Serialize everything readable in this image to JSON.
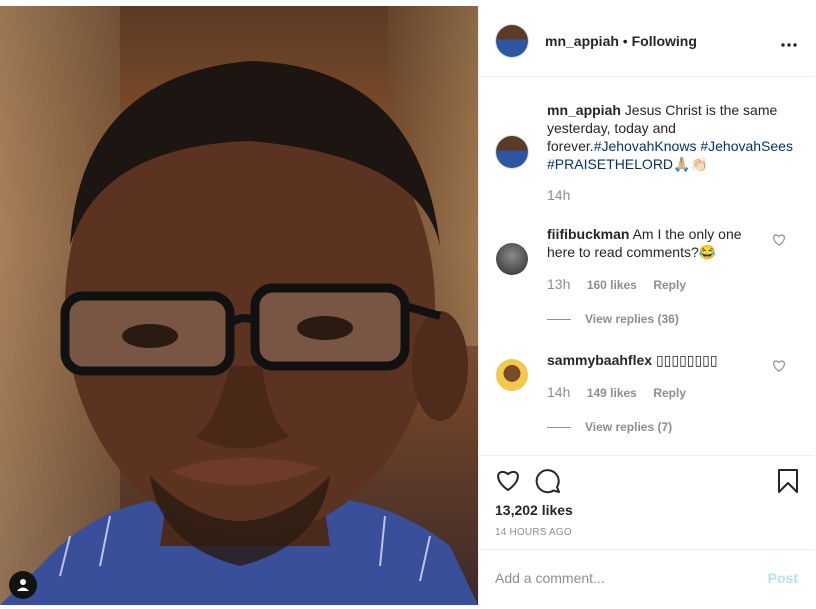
{
  "post": {
    "username": "mn_appiah",
    "separator": "•",
    "follow_status": "Following",
    "caption_text": "Jesus Christ is the same yesterday, today and forever.",
    "hashtags": [
      "#JehovahKnows",
      "#JehovahSees",
      "#PRAISETHELORD"
    ],
    "caption_emoji": "🙏🏼👏🏻",
    "caption_time": "14h",
    "likes": "13,202 likes",
    "date": "14 HOURS AGO"
  },
  "comments": [
    {
      "username": "fiifibuckman",
      "text": "Am I the only one here to read comments?😂",
      "time": "13h",
      "likes": "160 likes",
      "reply": "Reply",
      "view_replies": "View replies (36)"
    },
    {
      "username": "sammybaahflex",
      "text": "▯▯▯▯▯▯▯▯",
      "time": "14h",
      "likes": "149 likes",
      "reply": "Reply",
      "view_replies": "View replies (7)"
    }
  ],
  "composer": {
    "placeholder": "Add a comment...",
    "post_label": "Post"
  },
  "icons": {
    "more": "more-options-icon",
    "like": "heart-icon",
    "comment": "comment-icon",
    "save": "bookmark-icon",
    "user": "user-icon"
  },
  "colors": {
    "hashtag": "#003569",
    "muted": "#8e8e8e",
    "post_disabled": "#b2dffc"
  }
}
